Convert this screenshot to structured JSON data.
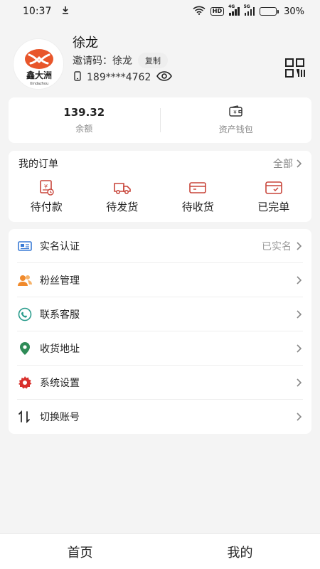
{
  "status_bar": {
    "time": "10:37",
    "battery_text": "30%",
    "battery_level": 0.3,
    "hd_label": "HD",
    "net1": "4G",
    "net2": "5G",
    "icons": [
      "download-icon",
      "wifi-icon",
      "hd-icon",
      "signal-icon",
      "signal-icon",
      "battery-icon"
    ]
  },
  "profile": {
    "name": "徐龙",
    "invite_label": "邀请码：",
    "invite_code": "徐龙",
    "copy_label": "复制",
    "phone": "189****4762",
    "avatar_logo_text": "鑫大洲",
    "avatar_logo_sub": "Xindazhou"
  },
  "wallet": {
    "balance_value": "139.32",
    "balance_label": "余额",
    "assets_label": "资产钱包"
  },
  "orders": {
    "title": "我的订单",
    "all_label": "全部",
    "items": [
      {
        "label": "待付款",
        "icon": "pending-payment-icon"
      },
      {
        "label": "待发货",
        "icon": "truck-icon"
      },
      {
        "label": "待收货",
        "icon": "receive-box-icon"
      },
      {
        "label": "已完单",
        "icon": "completed-box-icon"
      }
    ]
  },
  "menu": {
    "items": [
      {
        "label": "实名认证",
        "value": "已实名",
        "icon": "id-card-icon"
      },
      {
        "label": "粉丝管理",
        "value": "",
        "icon": "fans-icon"
      },
      {
        "label": "联系客服",
        "value": "",
        "icon": "customer-service-icon"
      },
      {
        "label": "收货地址",
        "value": "",
        "icon": "location-pin-icon"
      },
      {
        "label": "系统设置",
        "value": "",
        "icon": "gear-icon"
      },
      {
        "label": "切换账号",
        "value": "",
        "icon": "switch-account-icon"
      }
    ]
  },
  "colors": {
    "brand_orange": "#e8562b",
    "menu_icon_blue": "#3a7bd5",
    "menu_icon_orange": "#f08a2c",
    "menu_icon_green": "#2e8b57",
    "menu_icon_red": "#d9302c",
    "order_icon_red": "#c8453a"
  },
  "tabs": [
    {
      "label": "首页"
    },
    {
      "label": "我的"
    }
  ]
}
